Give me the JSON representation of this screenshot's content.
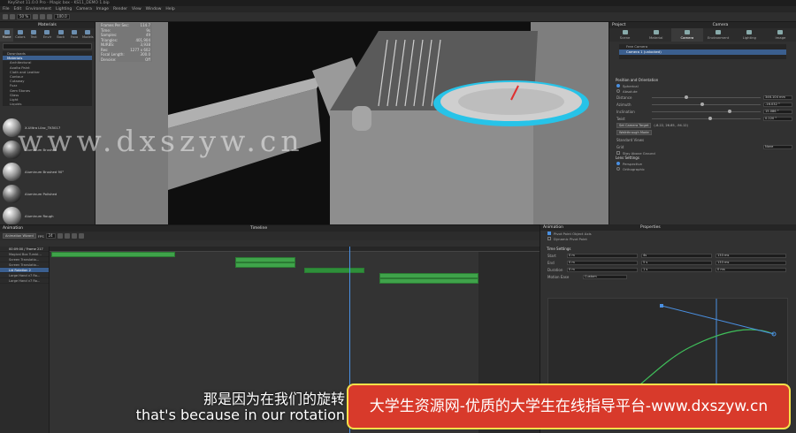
{
  "app": {
    "title": "KeyShot 11.0.0 Pro - Magic box - KS11_DEMO 1.bip"
  },
  "menu": [
    "File",
    "Edit",
    "Environment",
    "Lighting",
    "Camera",
    "Image",
    "Render",
    "View",
    "Window",
    "Help"
  ],
  "toolbar": {
    "zoom": "50 %",
    "field": "100.0"
  },
  "library": {
    "title": "Materials",
    "tabs": [
      "Mone",
      "Colors",
      "Text",
      "Envir",
      "Back",
      "Favo",
      "Models"
    ],
    "tree": [
      "Downloads",
      "Materials",
      "Architectural",
      "Axalta Paint",
      "Cloth and Leather",
      "Contour",
      "Cutaway",
      "Fuzz",
      "Gem Stones",
      "Glass",
      "Light",
      "Liquids"
    ],
    "thumbs": [
      "X-Ulitra Lilac_TK5017",
      "Aluminum Brushed",
      "Aluminum Brushed 90°",
      "Aluminum Polished",
      "Aluminum Rough"
    ]
  },
  "hud": [
    [
      "Frames Per Sec:",
      "114.7"
    ],
    [
      "Time:",
      "9s"
    ],
    [
      "Samples:",
      "49"
    ],
    [
      "Triangles:",
      "401,904"
    ],
    [
      "NURBS:",
      "3,938"
    ],
    [
      "Res:",
      "1277 x 602"
    ],
    [
      "Focal Length:",
      "300.0"
    ],
    [
      "Denoise:",
      "Off"
    ]
  ],
  "project": {
    "title": "Project",
    "camera_title": "Camera",
    "tabs": [
      "Scene",
      "Material",
      "Camera",
      "Environment",
      "Lighting",
      "Image"
    ],
    "cameras": [
      "Free Camera",
      "Camera 1 (unlocked)"
    ],
    "position_section": "Position and Orientation",
    "radio1": "Spherical",
    "radio2": "Absolute",
    "rows": [
      [
        "Distance",
        "346.104 mm"
      ],
      [
        "Azimuth",
        "-16.032 °"
      ],
      [
        "Inclination",
        "15.086 °"
      ],
      [
        "Twist",
        "0.220 °"
      ]
    ],
    "set_target": "Set Camera Target",
    "target_val": "(-8.22, 26.85, -94.12)",
    "walkthrough": "Walkthrough Mode",
    "std_views": "Standard Views",
    "grid": "Grid",
    "grid_val": "None",
    "stay_above": "Stay Above Ground",
    "lens_section": "Lens Settings",
    "perspective": "Perspective",
    "orthographic": "Orthographic"
  },
  "animation": {
    "title": "Animation",
    "timeline_title": "Timeline",
    "wizard": "Animation Wizard",
    "fps_label": "FPS",
    "fps": "24",
    "time": "00:09:00 / Frame 217",
    "tracks": [
      "Magical Box Tumbl...",
      "Screen Translatio...",
      "Screen Translatio...",
      "Lid Rotation 2",
      "Large Hand v7 Ro...",
      "Large Hand v7 Ro..."
    ]
  },
  "anim_props": {
    "title": "Animation",
    "props_title": "Properties",
    "pivot": "Pivot Point Object Axis",
    "dynamic": "Dynamic Pivot Point",
    "section": "Time Settings",
    "rows": [
      [
        "Start",
        "0 m",
        "4s",
        "133 ms"
      ],
      [
        "End",
        "0 m",
        "5 s",
        "133 ms"
      ],
      [
        "Duration",
        "0 m",
        "1 s",
        "0 ms"
      ]
    ],
    "motion_ease_label": "Motion Ease",
    "motion_ease": "Custom"
  },
  "watermark": "www.dxszyw.cn",
  "subtitle": {
    "cn": "那是因为在我们的旋转",
    "en": "that's because in our rotation"
  },
  "banner": "大学生资源网-优质的大学生在线指导平台-www.dxszyw.cn"
}
